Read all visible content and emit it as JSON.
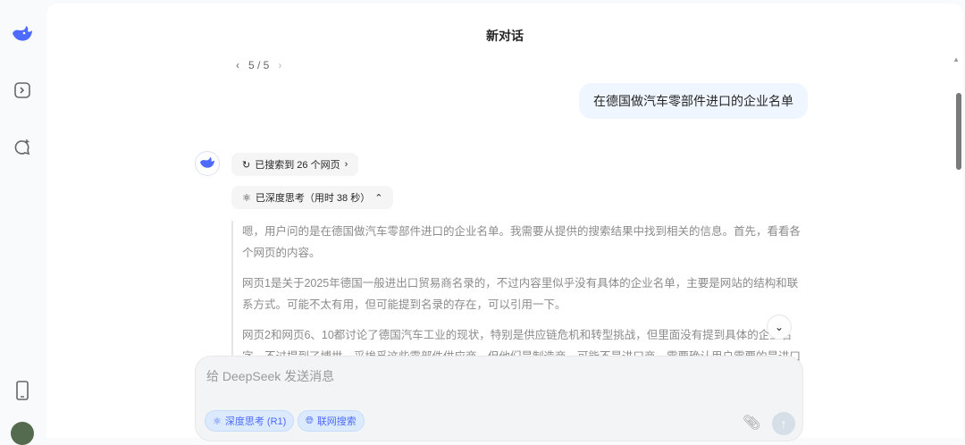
{
  "header": {
    "title": "新对话",
    "pager": "5 / 5"
  },
  "user_message": "在德国做汽车零部件进口的企业名单",
  "search_chip": "已搜索到 26 个网页",
  "think_chip": "已深度思考（用时 38 秒）",
  "thinking": [
    "嗯，用户问的是在德国做汽车零部件进口的企业名单。我需要从提供的搜索结果中找到相关的信息。首先，看看各个网页的内容。",
    "网页1是关于2025年德国一般进出口贸易商名录的，不过内容里似乎没有具体的企业名单，主要是网站的结构和联系方式。可能不太有用，但可能提到名录的存在，可以引用一下。",
    "网页2和网页6、10都讨论了德国汽车工业的现状，特别是供应链危机和转型挑战，但里面没有提到具体的企业名字，不过提到了博世、采埃孚这些零部件供应商，但他们是制造商，可能不是进口商。需要确认用户需要的是进口商还是供应"
  ],
  "input": {
    "placeholder": "给 DeepSeek 发送消息",
    "deep_think": "深度思考 (R1)",
    "web_search": "联网搜索"
  }
}
